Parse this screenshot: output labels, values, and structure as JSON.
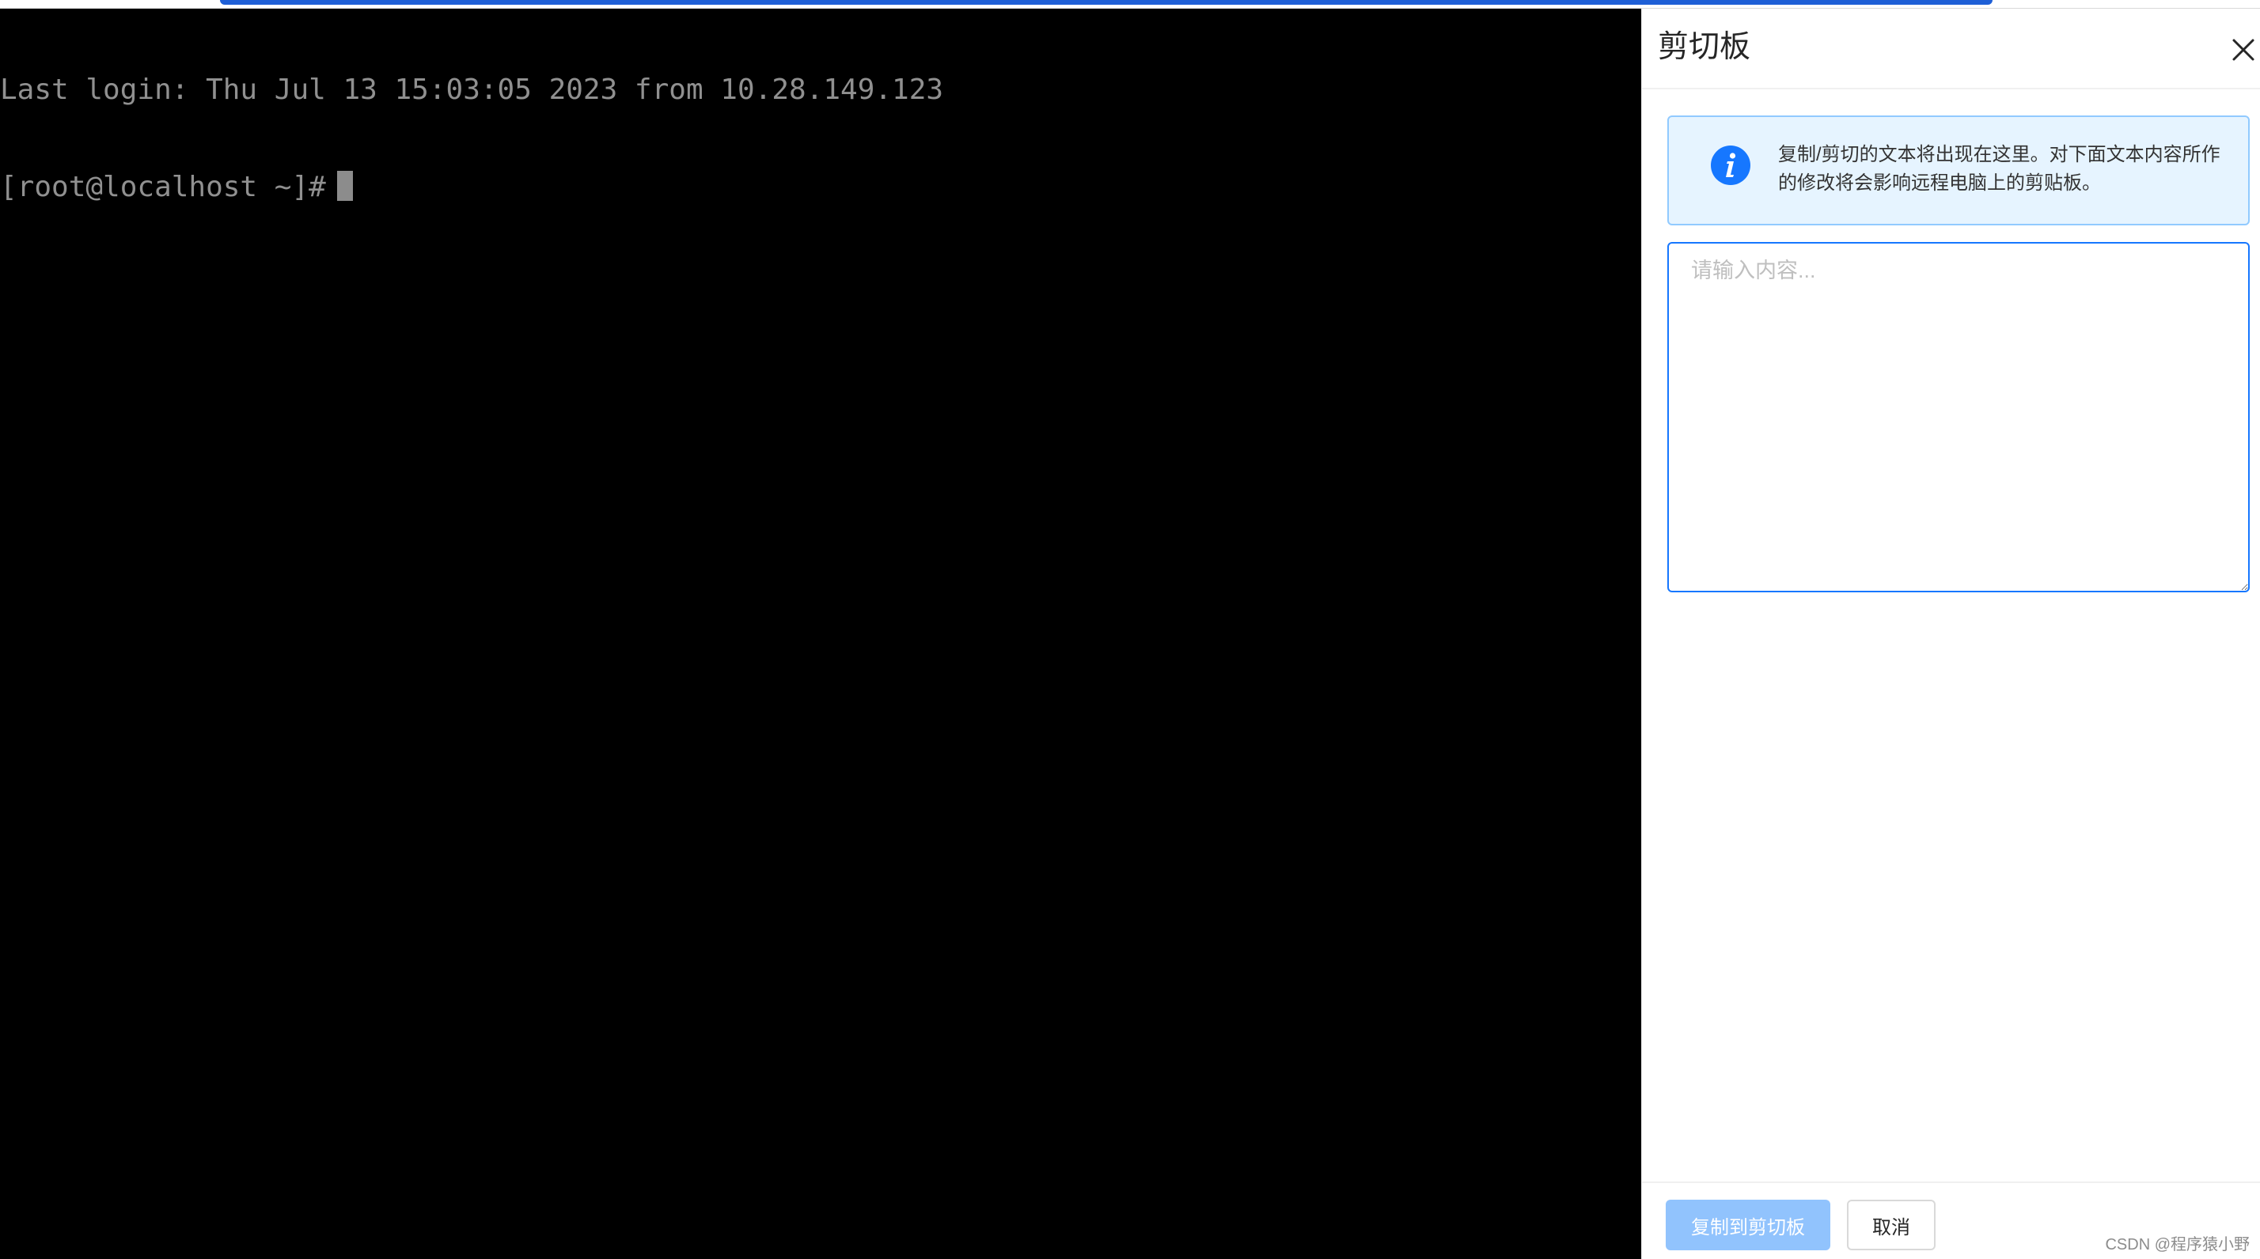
{
  "terminal": {
    "lines": [
      "Last login: Thu Jul 13 15:03:05 2023 from 10.28.149.123",
      "[root@localhost ~]#"
    ]
  },
  "drawer": {
    "title": "剪切板",
    "alert_text": "复制/剪切的文本将出现在这里。对下面文本内容所作的修改将会影响远程电脑上的剪贴板。",
    "textarea": {
      "value": "",
      "placeholder": "请输入内容..."
    },
    "buttons": {
      "copy_label": "复制到剪切板",
      "cancel_label": "取消"
    },
    "icons": {
      "close": "close-icon",
      "info": "info-icon"
    }
  },
  "watermark": "CSDN @程序猿小野",
  "colors": {
    "accent": "#1677ff",
    "alert_bg": "#e6f4ff",
    "primary_disabled": "#91c3fd",
    "top_bar": "#1e5fd6"
  }
}
